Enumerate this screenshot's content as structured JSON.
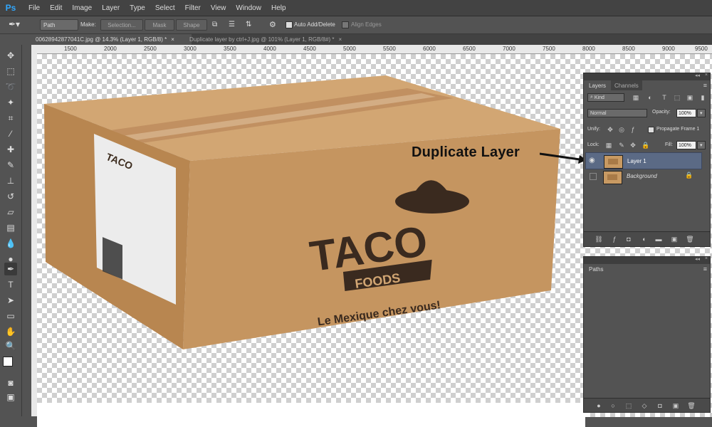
{
  "menu": {
    "logo": "Ps",
    "items": [
      "File",
      "Edit",
      "Image",
      "Layer",
      "Type",
      "Select",
      "Filter",
      "View",
      "Window",
      "Help"
    ]
  },
  "options": {
    "tool_mode": "Path",
    "make_label": "Make:",
    "selection_btn": "Selection...",
    "mask_btn": "Mask",
    "shape_btn": "Shape",
    "auto_add_delete": "Auto Add/Delete",
    "align_edges": "Align Edges"
  },
  "tabs": [
    {
      "label": "00628942877041C.jpg @ 14.3% (Layer 1, RGB/8) *"
    },
    {
      "label": "Duplicate layer by ctrl+J.jpg @ 101% (Layer 1, RGB/8#) *"
    }
  ],
  "ruler": {
    "ticks": [
      "1500",
      "2000",
      "2500",
      "3000",
      "3500",
      "4000",
      "4500",
      "5000",
      "5500",
      "6000",
      "6500",
      "7000",
      "7500",
      "8000",
      "8500",
      "9000",
      "9500"
    ]
  },
  "artwork": {
    "brand": "TACO",
    "sub_brand": "FOODS",
    "tagline": "Le Mexique chez vous!"
  },
  "annotation": {
    "text": "Duplicate Layer"
  },
  "layers_panel": {
    "tabs": [
      "Layers",
      "Channels"
    ],
    "kind_filter": "Kind",
    "blend_mode": "Normal",
    "opacity_label": "Opacity:",
    "opacity_value": "100%",
    "unify_label": "Unify:",
    "propagate_label": "Propagate Frame 1",
    "lock_label": "Lock:",
    "fill_label": "Fill:",
    "fill_value": "100%",
    "layers": [
      {
        "name": "Layer 1",
        "selected": true
      },
      {
        "name": "Background",
        "selected": false
      }
    ]
  },
  "paths_panel": {
    "tab": "Paths"
  },
  "colors": {
    "accent": "#31a8ff",
    "selected_layer": "#5b6a85",
    "box": "#c59560"
  }
}
